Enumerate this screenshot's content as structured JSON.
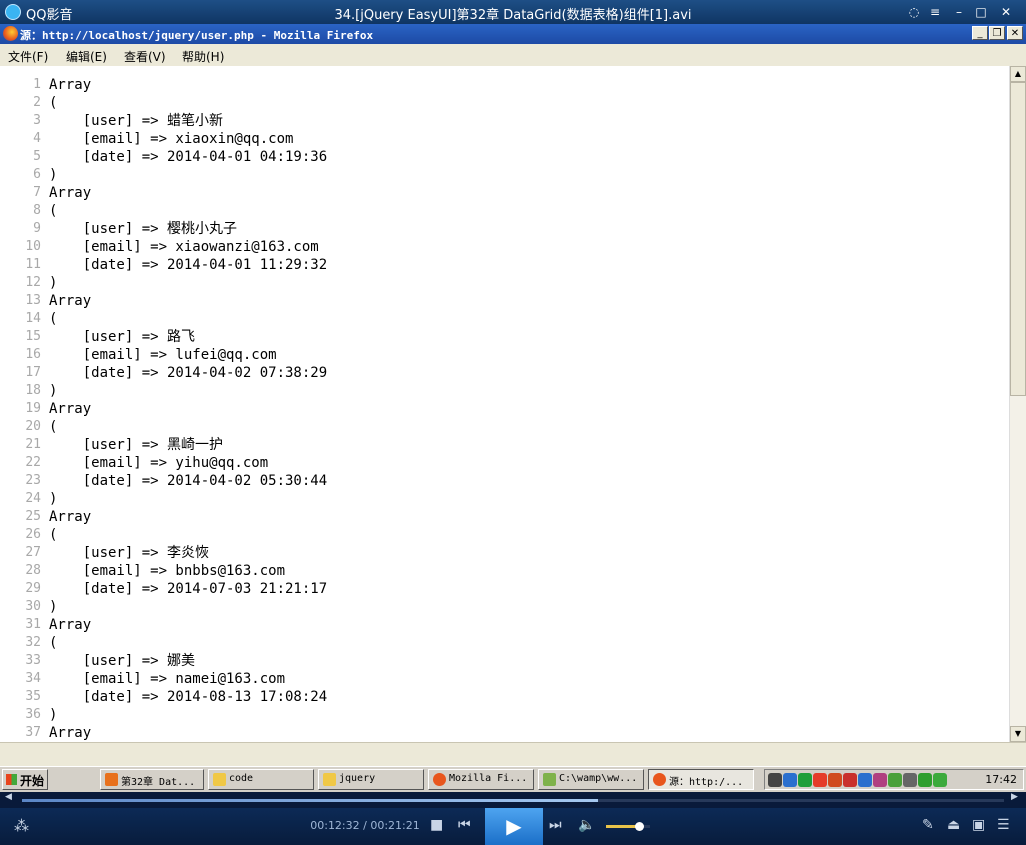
{
  "player": {
    "app_name": "QQ影音",
    "file_name": "34.[jQuery EasyUI]第32章 DataGrid(数据表格)组件[1].avi",
    "current_time": "00:12:32",
    "total_time": "00:21:21",
    "time_separator": " / ",
    "progress": 0.587,
    "volume": 0.75
  },
  "browser": {
    "window_title": "源：http://localhost/jquery/user.php - Mozilla Firefox",
    "menu": [
      "文件(F)",
      "编辑(E)",
      "查看(V)",
      "帮助(H)"
    ]
  },
  "source_lines": [
    {
      "n": "1",
      "t": "Array"
    },
    {
      "n": "2",
      "t": "("
    },
    {
      "n": "3",
      "t": "    [user] => 蜡笔小新"
    },
    {
      "n": "4",
      "t": "    [email] => xiaoxin@qq.com"
    },
    {
      "n": "5",
      "t": "    [date] => 2014-04-01 04:19:36"
    },
    {
      "n": "6",
      "t": ")"
    },
    {
      "n": "7",
      "t": "Array"
    },
    {
      "n": "8",
      "t": "("
    },
    {
      "n": "9",
      "t": "    [user] => 樱桃小丸子"
    },
    {
      "n": "10",
      "t": "    [email] => xiaowanzi@163.com"
    },
    {
      "n": "11",
      "t": "    [date] => 2014-04-01 11:29:32"
    },
    {
      "n": "12",
      "t": ")"
    },
    {
      "n": "13",
      "t": "Array"
    },
    {
      "n": "14",
      "t": "("
    },
    {
      "n": "15",
      "t": "    [user] => 路飞"
    },
    {
      "n": "16",
      "t": "    [email] => lufei@qq.com"
    },
    {
      "n": "17",
      "t": "    [date] => 2014-04-02 07:38:29"
    },
    {
      "n": "18",
      "t": ")"
    },
    {
      "n": "19",
      "t": "Array"
    },
    {
      "n": "20",
      "t": "("
    },
    {
      "n": "21",
      "t": "    [user] => 黑崎一护"
    },
    {
      "n": "22",
      "t": "    [email] => yihu@qq.com"
    },
    {
      "n": "23",
      "t": "    [date] => 2014-04-02 05:30:44"
    },
    {
      "n": "24",
      "t": ")"
    },
    {
      "n": "25",
      "t": "Array"
    },
    {
      "n": "26",
      "t": "("
    },
    {
      "n": "27",
      "t": "    [user] => 李炎恢"
    },
    {
      "n": "28",
      "t": "    [email] => bnbbs@163.com"
    },
    {
      "n": "29",
      "t": "    [date] => 2014-07-03 21:21:17"
    },
    {
      "n": "30",
      "t": ")"
    },
    {
      "n": "31",
      "t": "Array"
    },
    {
      "n": "32",
      "t": "("
    },
    {
      "n": "33",
      "t": "    [user] => 娜美"
    },
    {
      "n": "34",
      "t": "    [email] => namei@163.com"
    },
    {
      "n": "35",
      "t": "    [date] => 2014-08-13 17:08:24"
    },
    {
      "n": "36",
      "t": ")"
    },
    {
      "n": "37",
      "t": "Array"
    }
  ],
  "taskbar": {
    "start_label": "开始",
    "tasks": [
      {
        "label": "第32章 Dat...",
        "icon": "qq-player-icon",
        "color": "#e8711c"
      },
      {
        "label": "code",
        "icon": "folder-icon",
        "color": "#f0c846"
      },
      {
        "label": "jquery",
        "icon": "folder-icon",
        "color": "#f0c846"
      },
      {
        "label": "Mozilla Fi...",
        "icon": "firefox-icon",
        "color": "#e8561d"
      },
      {
        "label": "C:\\wamp\\ww...",
        "icon": "notepad-icon",
        "color": "#7fb24a"
      },
      {
        "label": "源：http:/...",
        "icon": "firefox-icon",
        "color": "#e8561d"
      }
    ],
    "clock": "17:42",
    "tray_icons": [
      {
        "name": "keyboard-icon",
        "color": "#444444"
      },
      {
        "name": "network-icon",
        "color": "#2b6fce"
      },
      {
        "name": "app-green-icon",
        "color": "#1f9e3a"
      },
      {
        "name": "qq-penguin-icon",
        "color": "#e53c2a"
      },
      {
        "name": "chart-icon",
        "color": "#d04a1e"
      },
      {
        "name": "shield-red-icon",
        "color": "#c9302c"
      },
      {
        "name": "wifi-icon",
        "color": "#2b6fce"
      },
      {
        "name": "security-icon",
        "color": "#b04080"
      },
      {
        "name": "update-icon",
        "color": "#4aa03a"
      },
      {
        "name": "speaker-icon",
        "color": "#666666"
      },
      {
        "name": "arrows-icon",
        "color": "#2e9e2e"
      },
      {
        "name": "shield-green-icon",
        "color": "#3caa3c"
      }
    ]
  }
}
